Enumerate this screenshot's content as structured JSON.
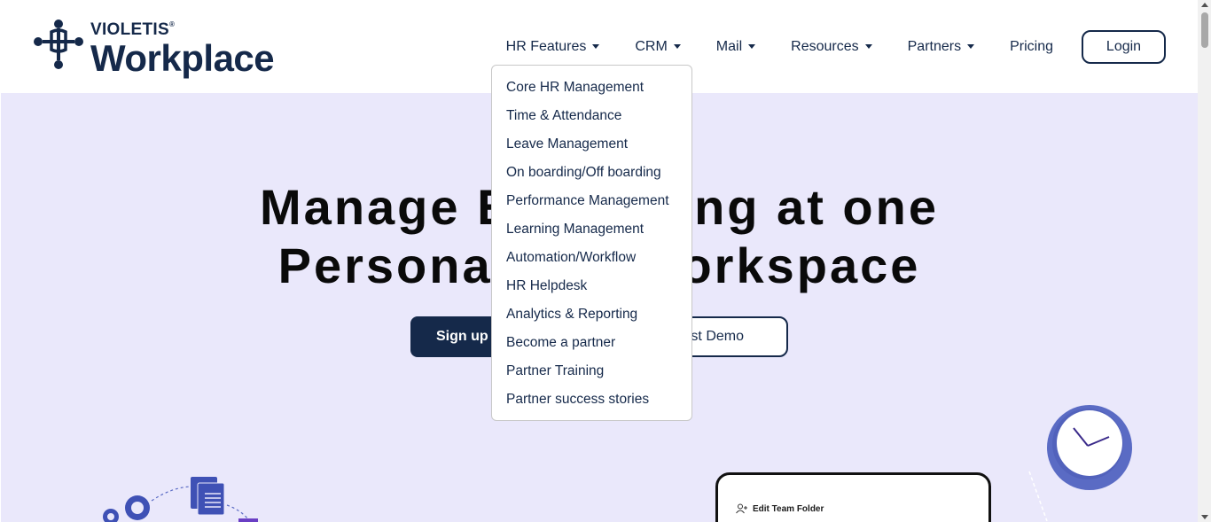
{
  "brand": {
    "name_small": "VIOLETIS",
    "registered": "®",
    "name_big": "Workplace",
    "color": "#15294a"
  },
  "nav": {
    "items": [
      {
        "label": "HR Features",
        "has_caret": true
      },
      {
        "label": "CRM",
        "has_caret": true
      },
      {
        "label": "Mail",
        "has_caret": true
      },
      {
        "label": "Resources",
        "has_caret": true
      },
      {
        "label": "Partners",
        "has_caret": true
      },
      {
        "label": "Pricing",
        "has_caret": false
      }
    ],
    "login_label": "Login"
  },
  "dropdown": {
    "items": [
      "Core HR Management",
      "Time & Attendance",
      "Leave Management",
      "On boarding/Off boarding",
      "Performance Management",
      "Learning Management",
      "Automation/Workflow",
      "HR Helpdesk",
      "Analytics & Reporting",
      "Become a partner",
      "Partner Training",
      "Partner success stories"
    ]
  },
  "hero": {
    "title_line1": "Manage Everything at one",
    "title_line2": "Personalized Workspace",
    "signup_label": "Sign up for free",
    "demo_label": "Request Demo",
    "card_label": "Edit Team Folder",
    "background": "#eae8fb"
  },
  "icons": {
    "logo": "violetis-logo-icon",
    "clock": "clock-icon",
    "gears": "gears-icon",
    "document": "document-icon",
    "add_user": "add-user-icon"
  }
}
